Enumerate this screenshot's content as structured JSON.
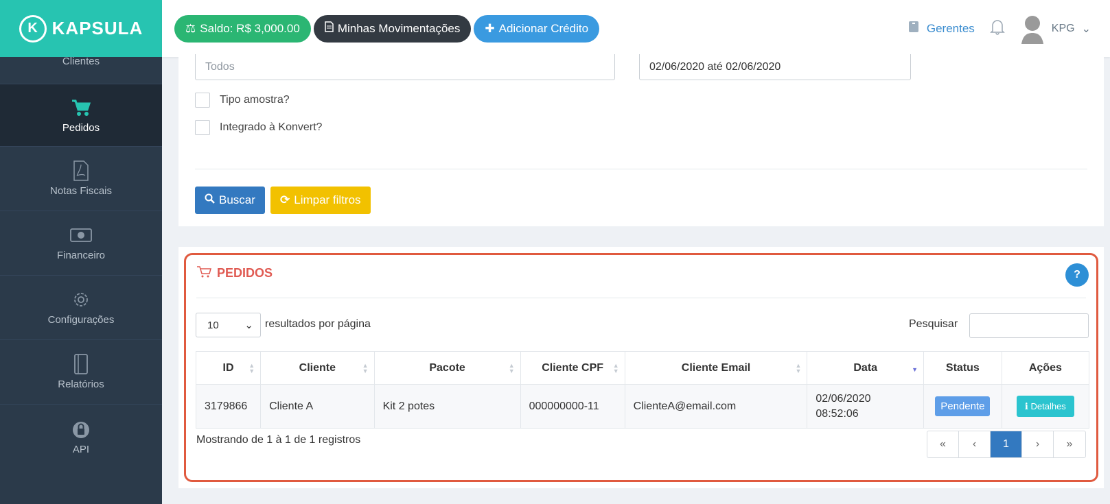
{
  "brand": {
    "name": "KAPSULA"
  },
  "sidebar": {
    "items": [
      {
        "label": "Clientes",
        "icon": "users-icon"
      },
      {
        "label": "Pedidos",
        "icon": "cart-icon"
      },
      {
        "label": "Notas Fiscais",
        "icon": "pdf-icon"
      },
      {
        "label": "Financeiro",
        "icon": "money-icon"
      },
      {
        "label": "Configurações",
        "icon": "gear-icon"
      },
      {
        "label": "Relatórios",
        "icon": "notebook-icon"
      },
      {
        "label": "API",
        "icon": "lock-icon"
      }
    ]
  },
  "topbar": {
    "saldo": "Saldo: R$ 3,000.00",
    "movimentacoes": "Minhas Movimentações",
    "adicionar": "Adicionar Crédito",
    "gerentes": "Gerentes",
    "user": "KPG"
  },
  "filters": {
    "tipo_value": "Todos",
    "date_value": "02/06/2020 até 02/06/2020",
    "check_amostra": "Tipo amostra?",
    "check_konvert": "Integrado à Konvert?",
    "buscar": "Buscar",
    "limpar": "Limpar filtros"
  },
  "pedidos": {
    "title": "PEDIDOS",
    "help": "?",
    "page_length": "10",
    "page_length_label": "resultados por página",
    "search_label": "Pesquisar",
    "columns": [
      "ID",
      "Cliente",
      "Pacote",
      "Cliente CPF",
      "Cliente Email",
      "Data",
      "Status",
      "Ações"
    ],
    "rows": [
      {
        "id": "3179866",
        "cliente": "Cliente A",
        "pacote": "Kit 2 potes",
        "cpf": "000000000-11",
        "email": "ClienteA@email.com",
        "data_date": "02/06/2020",
        "data_time": "08:52:06",
        "status": "Pendente",
        "acao": "Detalhes"
      }
    ],
    "info": "Mostrando de 1 à 1 de 1 registros",
    "pager": {
      "first": "«",
      "prev": "‹",
      "current": "1",
      "next": "›",
      "last": "»"
    }
  },
  "colors": {
    "brand": "#27c4b1",
    "sidebar": "#2b3a4a",
    "highlight": "#e05a3f",
    "title": "#e05a52"
  }
}
